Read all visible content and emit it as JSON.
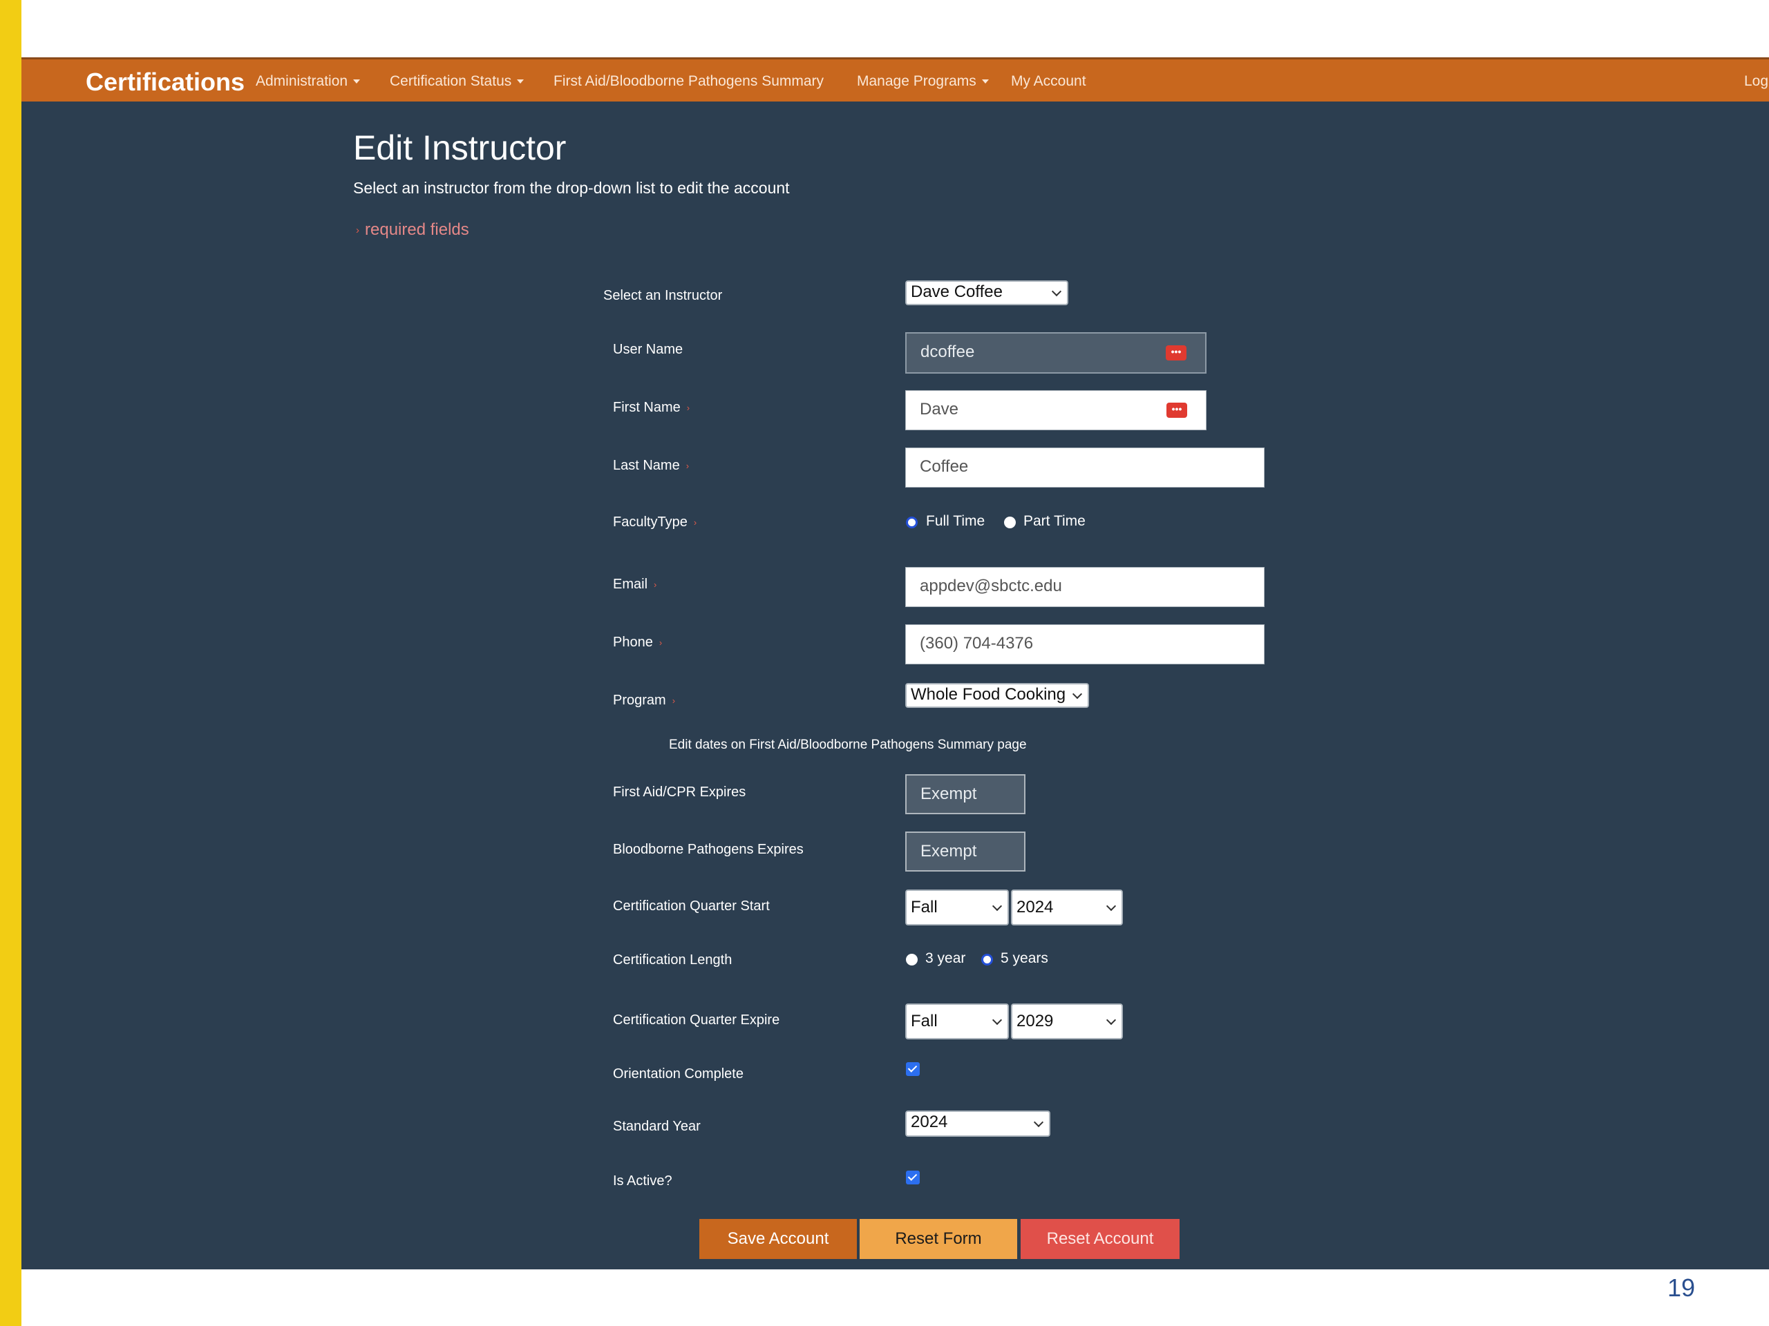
{
  "nav": {
    "brand": "Certifications",
    "items": [
      "Administration",
      "Certification Status",
      "First Aid/Bloodborne Pathogens Summary",
      "Manage Programs",
      "My Account"
    ],
    "logout": "Log"
  },
  "page": {
    "title": "Edit Instructor",
    "subtitle": "Select an instructor from the drop-down list to edit the account",
    "required_note": "required fields",
    "page_number": "19"
  },
  "form": {
    "select_instructor": {
      "label": "Select an Instructor",
      "value": "Dave Coffee"
    },
    "user_name": {
      "label": "User Name",
      "value": "dcoffee"
    },
    "first_name": {
      "label": "First Name",
      "value": "Dave"
    },
    "last_name": {
      "label": "Last Name",
      "value": "Coffee"
    },
    "faculty_type": {
      "label": "FacultyType",
      "options": [
        "Full Time",
        "Part Time"
      ],
      "selected": "Full Time"
    },
    "email": {
      "label": "Email",
      "value": "appdev@sbctc.edu"
    },
    "phone": {
      "label": "Phone",
      "value": "(360) 704-4376"
    },
    "program": {
      "label": "Program",
      "value": "Whole Food Cooking"
    },
    "dates_note": "Edit dates on First Aid/Bloodborne Pathogens Summary page",
    "first_aid_expires": {
      "label": "First Aid/CPR Expires",
      "value": "Exempt"
    },
    "bloodborne_expires": {
      "label": "Bloodborne Pathogens Expires",
      "value": "Exempt"
    },
    "quarter_start": {
      "label": "Certification Quarter Start",
      "quarter": "Fall",
      "year": "2024"
    },
    "cert_length": {
      "label": "Certification Length",
      "options": [
        "3 year",
        "5 years"
      ],
      "selected": "5 years"
    },
    "quarter_expire": {
      "label": "Certification Quarter Expire",
      "quarter": "Fall",
      "year": "2029"
    },
    "orientation_complete": {
      "label": "Orientation Complete",
      "checked": true
    },
    "standard_year": {
      "label": "Standard Year",
      "value": "2024"
    },
    "is_active": {
      "label": "Is Active?",
      "checked": true
    }
  },
  "buttons": {
    "save": "Save Account",
    "reset_form": "Reset Form",
    "reset_account": "Reset Account"
  },
  "colors": {
    "nav_bg": "#c8671e",
    "page_bg": "#2c3e50",
    "left_bar": "#f2cd14",
    "reset_form": "#f0a64a",
    "reset_account": "#e0504a"
  }
}
